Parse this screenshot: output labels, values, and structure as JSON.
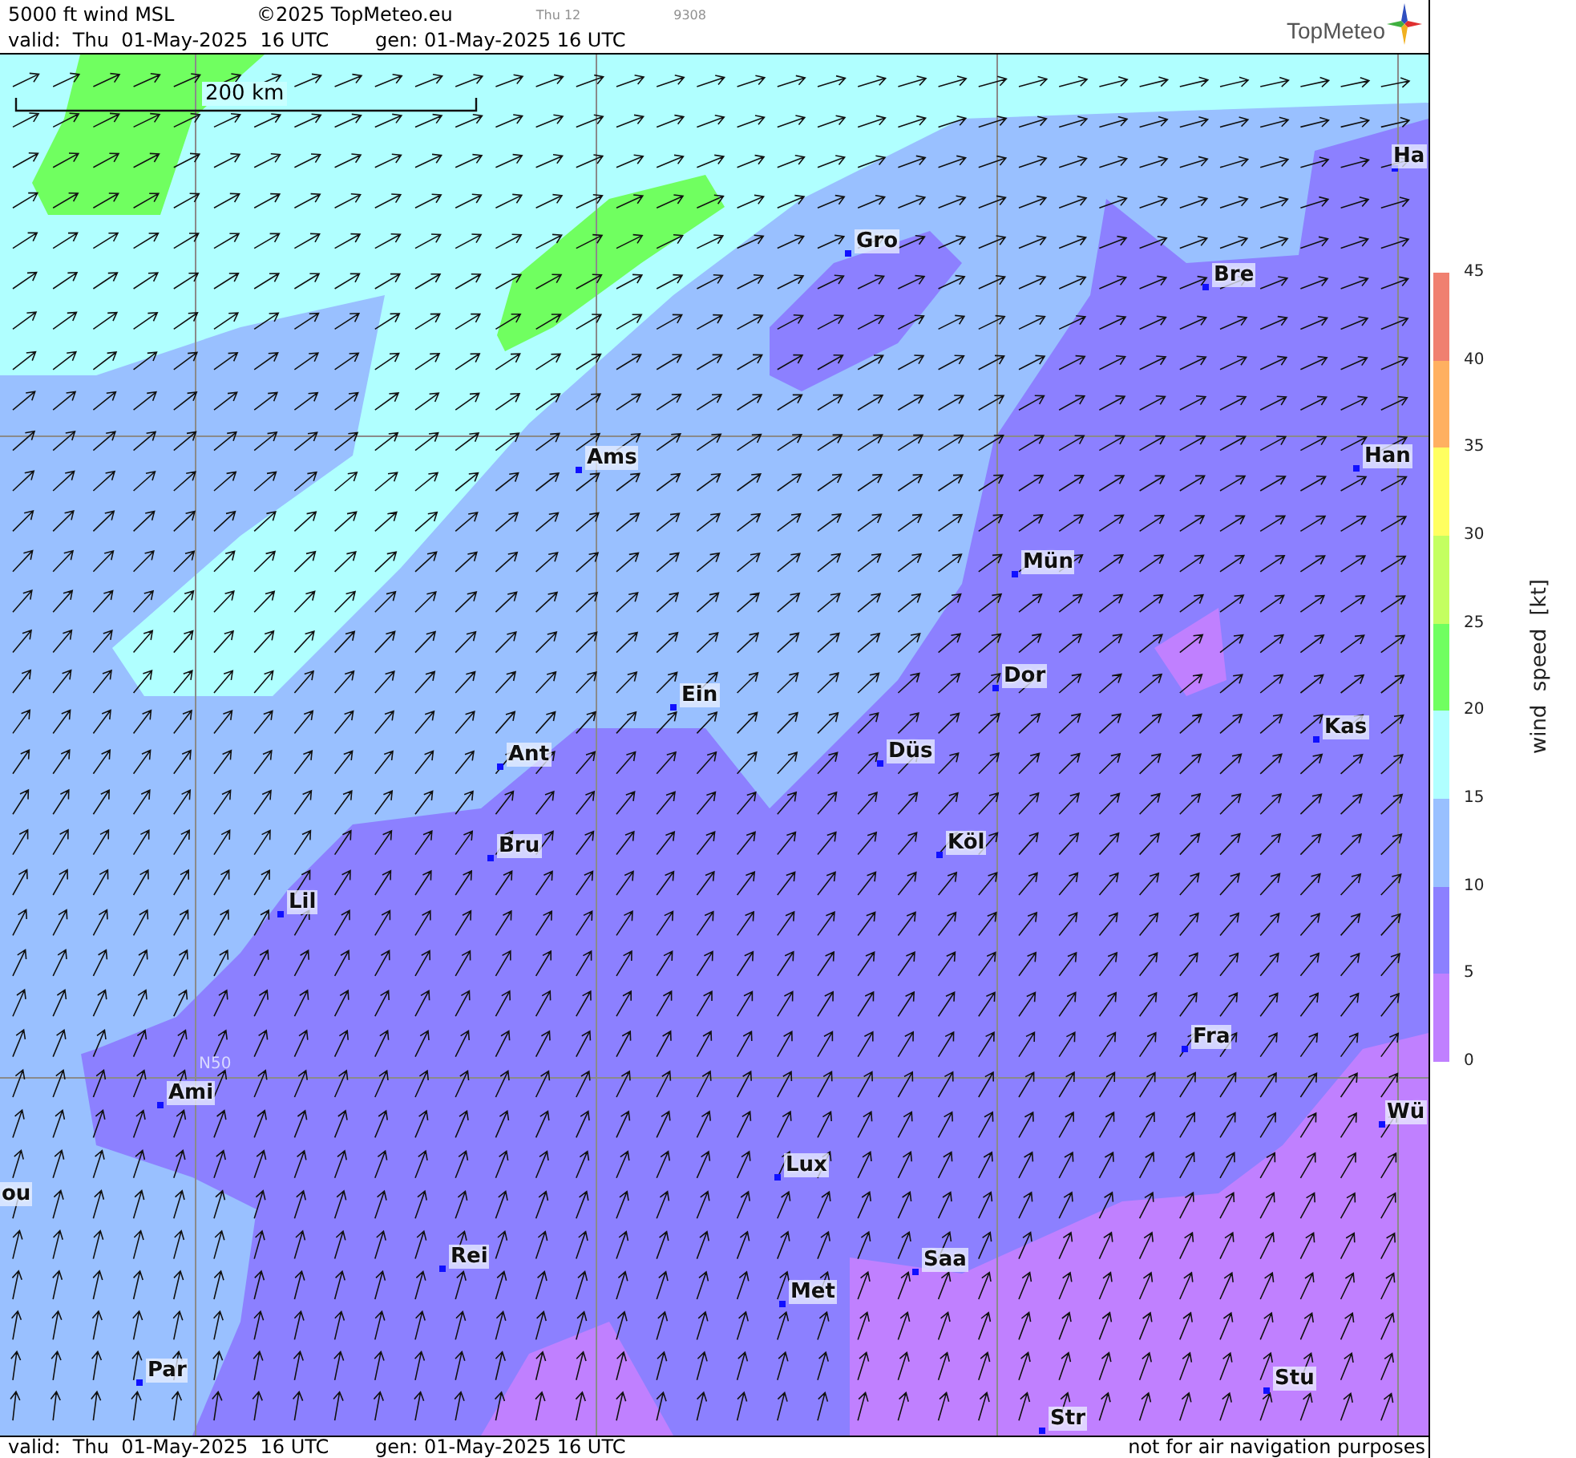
{
  "header": {
    "title": "5000 ft wind MSL",
    "copyright": "©2025 TopMeteo.eu",
    "time_code": "Thu 12",
    "run_id": "9308",
    "valid": "valid:  Thu  01-May-2025  16 UTC",
    "generated": "gen: 01-May-2025 16 UTC",
    "logo": "TopMeteo"
  },
  "map": {
    "scale": "200 km",
    "grid_label": "N50",
    "cities": [
      {
        "name": "Ha"
      },
      {
        "name": "Gro"
      },
      {
        "name": "Bre"
      },
      {
        "name": "Ams"
      },
      {
        "name": "Han"
      },
      {
        "name": "Mün"
      },
      {
        "name": "Dor"
      },
      {
        "name": "Ein"
      },
      {
        "name": "Kas"
      },
      {
        "name": "Düs"
      },
      {
        "name": "Ant"
      },
      {
        "name": "Köl"
      },
      {
        "name": "Bru"
      },
      {
        "name": "Lil"
      },
      {
        "name": "Fra"
      },
      {
        "name": "Ami"
      },
      {
        "name": "Wü"
      },
      {
        "name": "Lux"
      },
      {
        "name": "ou"
      },
      {
        "name": "Rei"
      },
      {
        "name": "Saa"
      },
      {
        "name": "Met"
      },
      {
        "name": "Par"
      },
      {
        "name": "Stu"
      },
      {
        "name": "Str"
      }
    ]
  },
  "legend": {
    "title": "wind speed [kt]",
    "ticks": [
      "45",
      "40",
      "35",
      "30",
      "25",
      "20",
      "15",
      "10",
      "5",
      "0"
    ],
    "bands": [
      {
        "color": "#f08070"
      },
      {
        "color": "#ffb060"
      },
      {
        "color": "#ffff60"
      },
      {
        "color": "#c4ff60"
      },
      {
        "color": "#70ff60"
      },
      {
        "color": "#b0ffff"
      },
      {
        "color": "#99c0ff"
      },
      {
        "color": "#8c80ff"
      },
      {
        "color": "#c080ff"
      }
    ]
  },
  "footer": {
    "valid": "valid:  Thu  01-May-2025  16 UTC",
    "generated": "gen: 01-May-2025 16 UTC",
    "notice": "not for air navigation purposes"
  }
}
